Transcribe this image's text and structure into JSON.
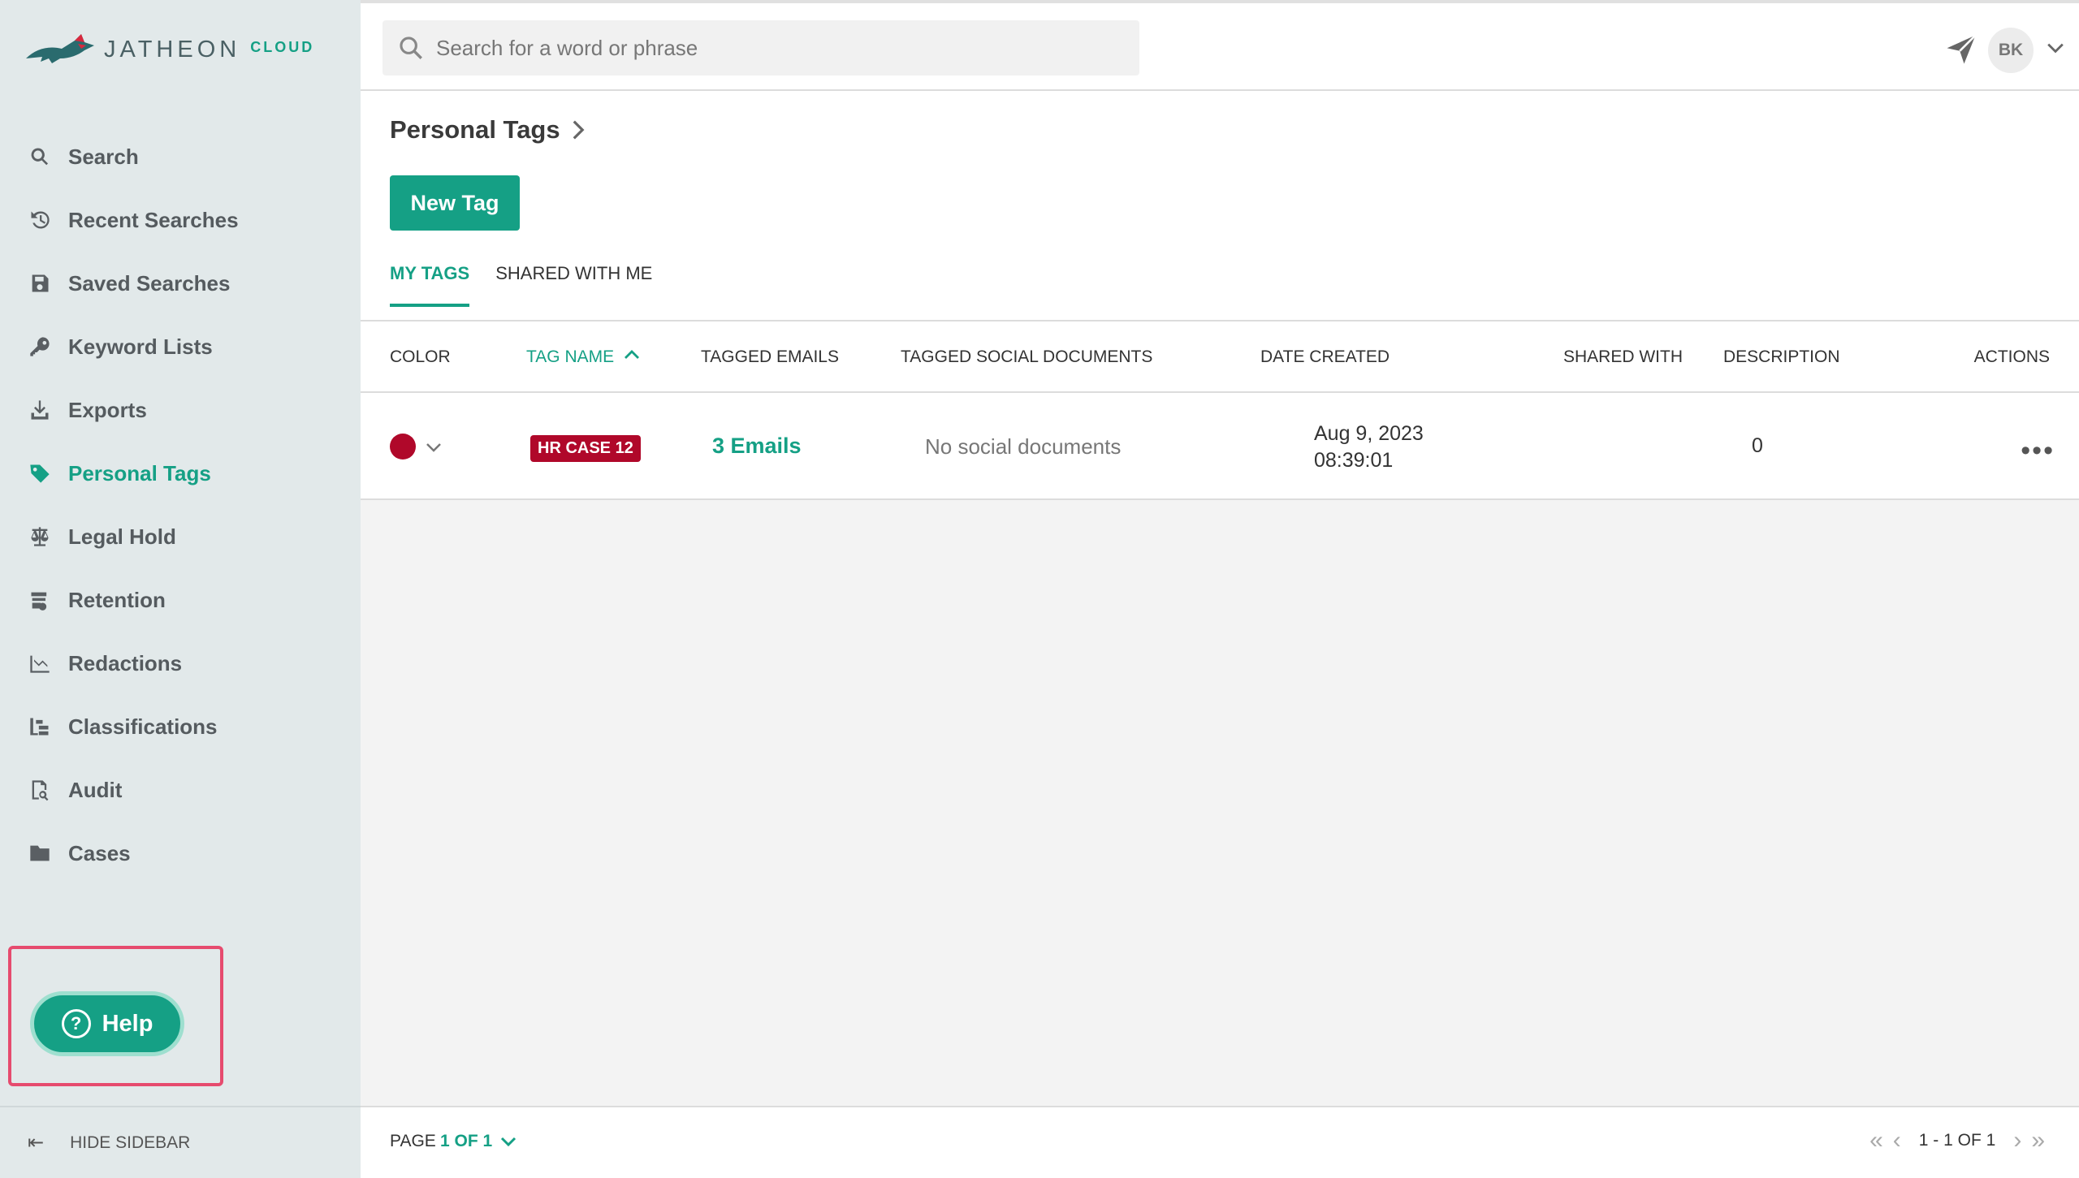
{
  "app": {
    "logo_text": "JATHEON",
    "logo_suffix": "CLOUD"
  },
  "sidebar": {
    "items": [
      {
        "label": "Search",
        "icon": "search-icon"
      },
      {
        "label": "Recent Searches",
        "icon": "history-icon"
      },
      {
        "label": "Saved Searches",
        "icon": "save-icon"
      },
      {
        "label": "Keyword Lists",
        "icon": "key-icon"
      },
      {
        "label": "Exports",
        "icon": "download-icon"
      },
      {
        "label": "Personal Tags",
        "icon": "tag-icon",
        "active": true
      },
      {
        "label": "Legal Hold",
        "icon": "scale-icon"
      },
      {
        "label": "Retention",
        "icon": "retention-icon"
      },
      {
        "label": "Redactions",
        "icon": "redaction-icon"
      },
      {
        "label": "Classifications",
        "icon": "classification-icon"
      },
      {
        "label": "Audit",
        "icon": "audit-icon"
      },
      {
        "label": "Cases",
        "icon": "folder-icon"
      }
    ],
    "help_label": "Help",
    "hide_label": "HIDE SIDEBAR"
  },
  "topbar": {
    "search_placeholder": "Search for a word or phrase",
    "avatar_initials": "BK"
  },
  "page": {
    "title": "Personal Tags",
    "new_tag_label": "New Tag",
    "tabs": [
      {
        "label": "MY TAGS",
        "active": true
      },
      {
        "label": "SHARED WITH ME",
        "active": false
      }
    ]
  },
  "table": {
    "columns": [
      "COLOR",
      "TAG NAME",
      "TAGGED EMAILS",
      "TAGGED SOCIAL DOCUMENTS",
      "DATE CREATED",
      "SHARED WITH",
      "DESCRIPTION",
      "ACTIONS"
    ],
    "rows": [
      {
        "color": "#b0082a",
        "tag_name": "HR CASE 12",
        "tagged_emails": "3 Emails",
        "tagged_social_documents": "No social documents",
        "date_created_date": "Aug 9, 2023",
        "date_created_time": "08:39:01",
        "shared_with": "",
        "description": "0",
        "actions": "•••"
      }
    ]
  },
  "footer": {
    "page_label": "PAGE",
    "page_value": "1 OF 1",
    "range": "1 - 1 OF 1"
  },
  "colors": {
    "accent": "#15a085",
    "tag_red": "#b0082a",
    "highlight_border": "#e64b6e"
  }
}
